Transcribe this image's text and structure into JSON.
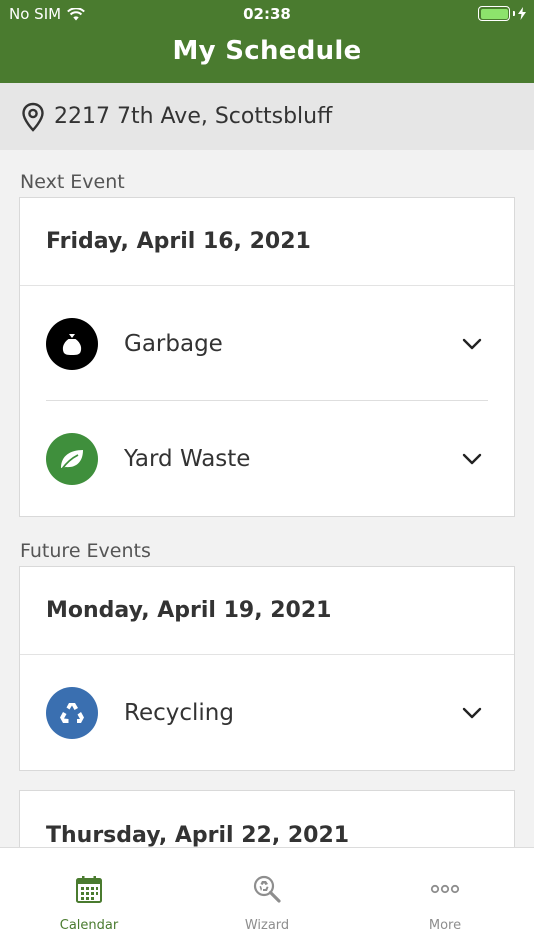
{
  "status_bar": {
    "carrier": "No SIM",
    "time": "02:38"
  },
  "header": {
    "title": "My Schedule"
  },
  "address": "2217 7th Ave, Scottsbluff",
  "next_event": {
    "section_label": "Next Event",
    "date": "Friday, April 16, 2021",
    "items": [
      {
        "label": "Garbage",
        "icon": "garbage-bag-icon",
        "color": "#000000"
      },
      {
        "label": "Yard Waste",
        "icon": "leaf-icon",
        "color": "#3f8f3c"
      }
    ]
  },
  "future_events": {
    "section_label": "Future Events",
    "groups": [
      {
        "date": "Monday, April 19, 2021",
        "items": [
          {
            "label": "Recycling",
            "icon": "recycle-icon",
            "color": "#3a6fb0"
          }
        ]
      },
      {
        "date": "Thursday, April 22, 2021",
        "items": []
      }
    ]
  },
  "tabs": [
    {
      "label": "Calendar",
      "icon": "calendar-icon",
      "active": true
    },
    {
      "label": "Wizard",
      "icon": "search-recycle-icon",
      "active": false
    },
    {
      "label": "More",
      "icon": "more-dots-icon",
      "active": false
    }
  ],
  "colors": {
    "brand": "#4a7b2f",
    "battery": "#8de36c"
  }
}
